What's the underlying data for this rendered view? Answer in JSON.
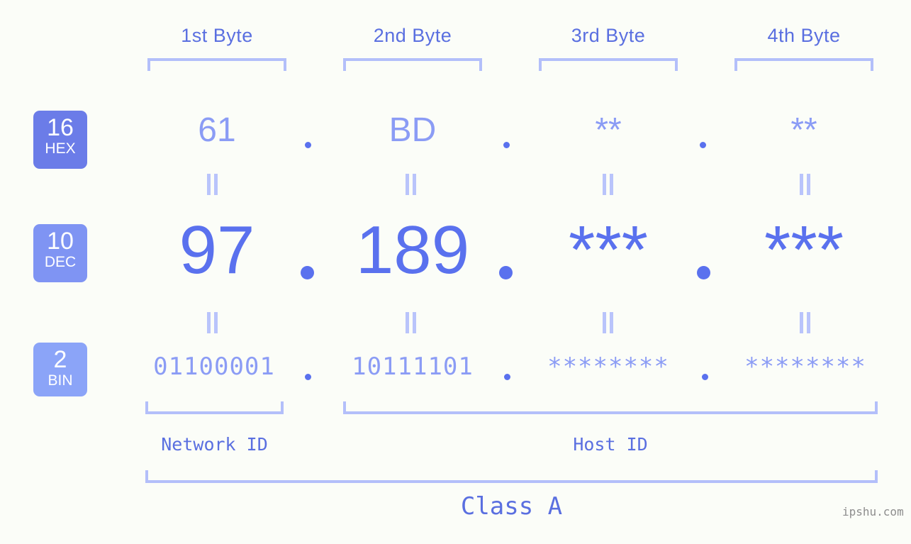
{
  "headers": [
    {
      "label": "1st Byte"
    },
    {
      "label": "2nd Byte"
    },
    {
      "label": "3rd Byte"
    },
    {
      "label": "4th Byte"
    }
  ],
  "radix_badges": [
    {
      "base": "16",
      "name": "HEX",
      "color": "#6b7ce8"
    },
    {
      "base": "10",
      "name": "DEC",
      "color": "#7f94f3"
    },
    {
      "base": "2",
      "name": "BIN",
      "color": "#8ba4f8"
    }
  ],
  "rows": {
    "hex": {
      "values": [
        "61",
        "BD",
        "**",
        "**"
      ]
    },
    "dec": {
      "values": [
        "97",
        "189",
        "***",
        "***"
      ]
    },
    "bin": {
      "values": [
        "01100001",
        "10111101",
        "********",
        "********"
      ]
    }
  },
  "separator": ".",
  "equals_symbol": "||",
  "sections": [
    {
      "label": "Network ID"
    },
    {
      "label": "Host ID"
    }
  ],
  "class_label": "Class A",
  "watermark": "ipshu.com",
  "colors": {
    "background": "#fbfdf8",
    "accent_strong": "#5a71ee",
    "accent_mid": "#5a6fe0",
    "accent_light": "#8b9cf5",
    "bracket": "#b3bffa",
    "equals": "#b9c4fb",
    "watermark": "#8d8d8d"
  }
}
